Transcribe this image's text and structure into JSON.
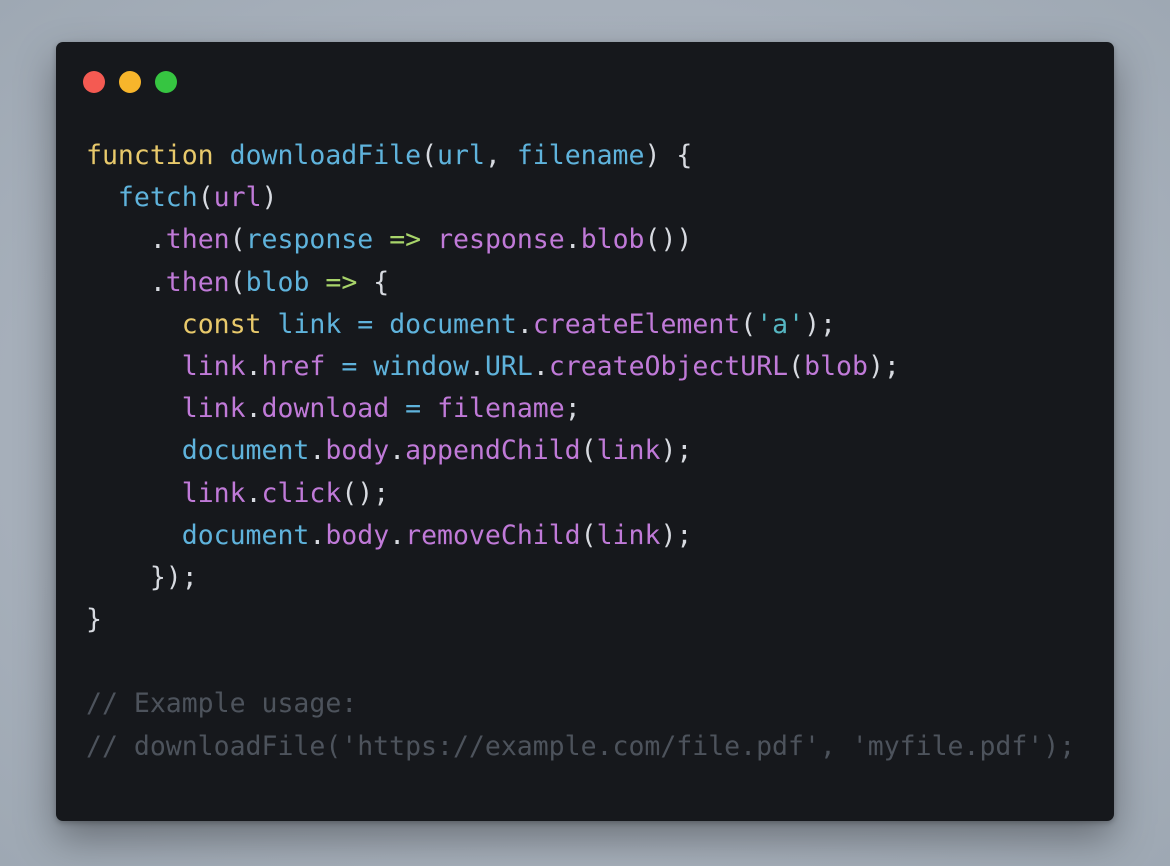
{
  "colors": {
    "background": "#a9b2bd",
    "window_bg": "#16181c",
    "plain": "#d7dae0",
    "keyword": "#e8c96b",
    "function": "#5fb3dc",
    "property": "#c07ad8",
    "string": "#56b6c2",
    "arrow": "#a8d46a",
    "comment": "#4d535c"
  },
  "window": {
    "controls": [
      {
        "name": "close",
        "color": "#f45a52"
      },
      {
        "name": "minimize",
        "color": "#f7b52b"
      },
      {
        "name": "maximize",
        "color": "#36c541"
      }
    ]
  },
  "code": {
    "language": "javascript",
    "lines": [
      [
        {
          "t": "function",
          "k": "keyword"
        },
        {
          "t": " ",
          "k": "plain"
        },
        {
          "t": "downloadFile",
          "k": "function"
        },
        {
          "t": "(",
          "k": "plain"
        },
        {
          "t": "url",
          "k": "function"
        },
        {
          "t": ", ",
          "k": "plain"
        },
        {
          "t": "filename",
          "k": "function"
        },
        {
          "t": ") {",
          "k": "plain"
        }
      ],
      [
        {
          "t": "  ",
          "k": "plain"
        },
        {
          "t": "fetch",
          "k": "function"
        },
        {
          "t": "(",
          "k": "plain"
        },
        {
          "t": "url",
          "k": "property"
        },
        {
          "t": ")",
          "k": "plain"
        }
      ],
      [
        {
          "t": "    .",
          "k": "plain"
        },
        {
          "t": "then",
          "k": "property"
        },
        {
          "t": "(",
          "k": "plain"
        },
        {
          "t": "response",
          "k": "function"
        },
        {
          "t": " ",
          "k": "plain"
        },
        {
          "t": "=>",
          "k": "arrow"
        },
        {
          "t": " ",
          "k": "plain"
        },
        {
          "t": "response",
          "k": "property"
        },
        {
          "t": ".",
          "k": "plain"
        },
        {
          "t": "blob",
          "k": "property"
        },
        {
          "t": "())",
          "k": "plain"
        }
      ],
      [
        {
          "t": "    .",
          "k": "plain"
        },
        {
          "t": "then",
          "k": "property"
        },
        {
          "t": "(",
          "k": "plain"
        },
        {
          "t": "blob",
          "k": "function"
        },
        {
          "t": " ",
          "k": "plain"
        },
        {
          "t": "=>",
          "k": "arrow"
        },
        {
          "t": " {",
          "k": "plain"
        }
      ],
      [
        {
          "t": "      ",
          "k": "plain"
        },
        {
          "t": "const",
          "k": "keyword"
        },
        {
          "t": " ",
          "k": "plain"
        },
        {
          "t": "link",
          "k": "function"
        },
        {
          "t": " ",
          "k": "plain"
        },
        {
          "t": "=",
          "k": "function"
        },
        {
          "t": " ",
          "k": "plain"
        },
        {
          "t": "document",
          "k": "function"
        },
        {
          "t": ".",
          "k": "plain"
        },
        {
          "t": "createElement",
          "k": "property"
        },
        {
          "t": "(",
          "k": "plain"
        },
        {
          "t": "'a'",
          "k": "string"
        },
        {
          "t": ");",
          "k": "plain"
        }
      ],
      [
        {
          "t": "      ",
          "k": "plain"
        },
        {
          "t": "link",
          "k": "property"
        },
        {
          "t": ".",
          "k": "plain"
        },
        {
          "t": "href",
          "k": "property"
        },
        {
          "t": " ",
          "k": "plain"
        },
        {
          "t": "=",
          "k": "function"
        },
        {
          "t": " ",
          "k": "plain"
        },
        {
          "t": "window",
          "k": "function"
        },
        {
          "t": ".",
          "k": "plain"
        },
        {
          "t": "URL",
          "k": "function"
        },
        {
          "t": ".",
          "k": "plain"
        },
        {
          "t": "createObjectURL",
          "k": "property"
        },
        {
          "t": "(",
          "k": "plain"
        },
        {
          "t": "blob",
          "k": "property"
        },
        {
          "t": ");",
          "k": "plain"
        }
      ],
      [
        {
          "t": "      ",
          "k": "plain"
        },
        {
          "t": "link",
          "k": "property"
        },
        {
          "t": ".",
          "k": "plain"
        },
        {
          "t": "download",
          "k": "property"
        },
        {
          "t": " ",
          "k": "plain"
        },
        {
          "t": "=",
          "k": "function"
        },
        {
          "t": " ",
          "k": "plain"
        },
        {
          "t": "filename",
          "k": "property"
        },
        {
          "t": ";",
          "k": "plain"
        }
      ],
      [
        {
          "t": "      ",
          "k": "plain"
        },
        {
          "t": "document",
          "k": "function"
        },
        {
          "t": ".",
          "k": "plain"
        },
        {
          "t": "body",
          "k": "property"
        },
        {
          "t": ".",
          "k": "plain"
        },
        {
          "t": "appendChild",
          "k": "property"
        },
        {
          "t": "(",
          "k": "plain"
        },
        {
          "t": "link",
          "k": "property"
        },
        {
          "t": ");",
          "k": "plain"
        }
      ],
      [
        {
          "t": "      ",
          "k": "plain"
        },
        {
          "t": "link",
          "k": "property"
        },
        {
          "t": ".",
          "k": "plain"
        },
        {
          "t": "click",
          "k": "property"
        },
        {
          "t": "();",
          "k": "plain"
        }
      ],
      [
        {
          "t": "      ",
          "k": "plain"
        },
        {
          "t": "document",
          "k": "function"
        },
        {
          "t": ".",
          "k": "plain"
        },
        {
          "t": "body",
          "k": "property"
        },
        {
          "t": ".",
          "k": "plain"
        },
        {
          "t": "removeChild",
          "k": "property"
        },
        {
          "t": "(",
          "k": "plain"
        },
        {
          "t": "link",
          "k": "property"
        },
        {
          "t": ");",
          "k": "plain"
        }
      ],
      [
        {
          "t": "    });",
          "k": "plain"
        }
      ],
      [
        {
          "t": "}",
          "k": "plain"
        }
      ],
      [],
      [
        {
          "t": "// Example usage:",
          "k": "comment"
        }
      ],
      [
        {
          "t": "// downloadFile('https://example.com/file.pdf', 'myfile.pdf');",
          "k": "comment"
        }
      ]
    ]
  }
}
